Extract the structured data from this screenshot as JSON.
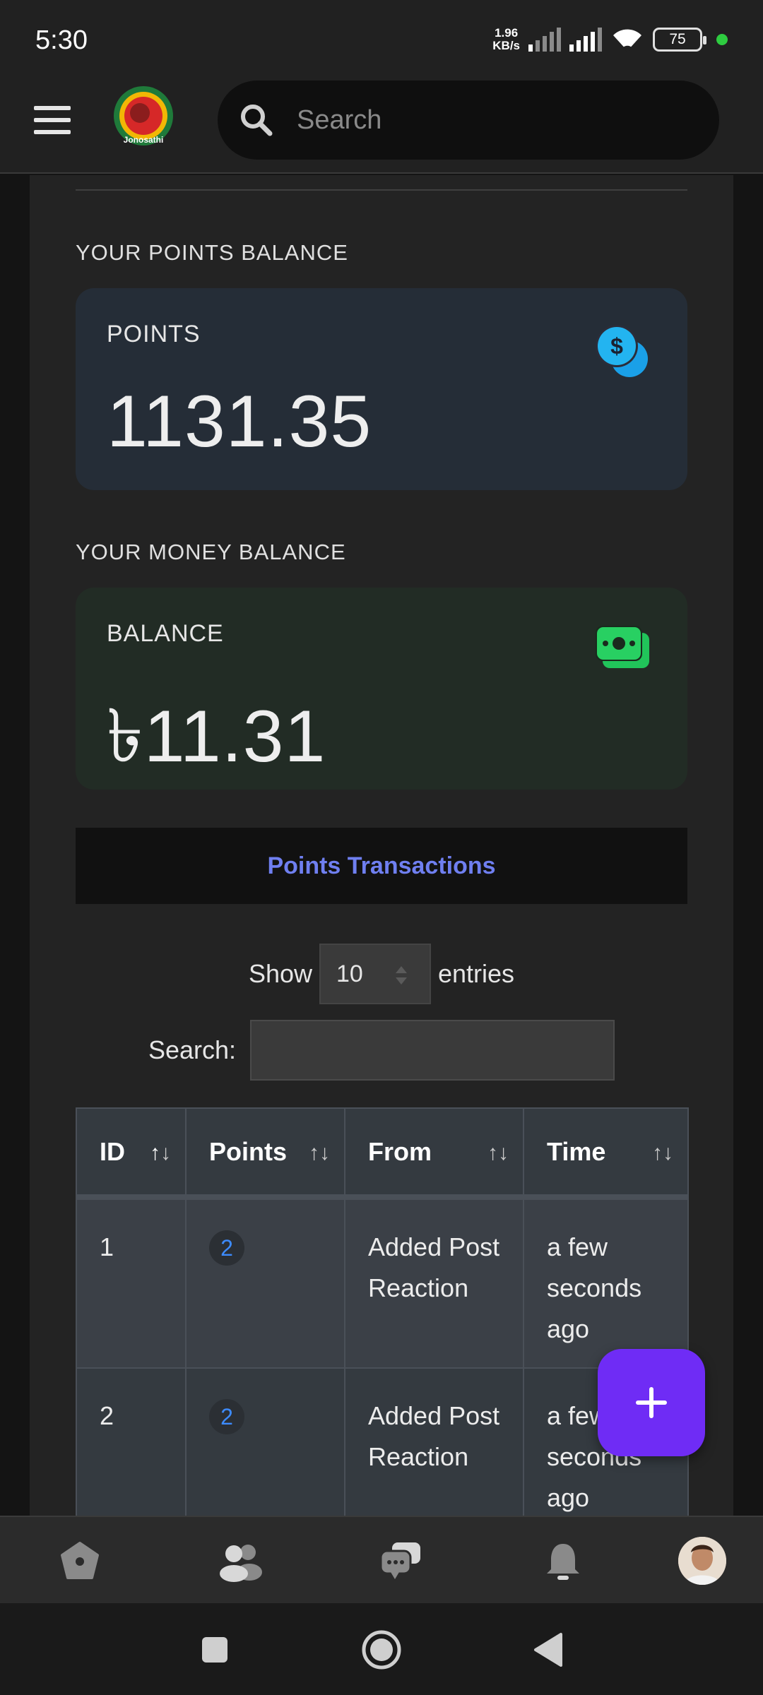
{
  "status_bar": {
    "time": "5:30",
    "net_speed_value": "1.96",
    "net_speed_unit": "KB/s",
    "battery": "75"
  },
  "header": {
    "logo_text": "Jonosathi",
    "search_placeholder": "Search"
  },
  "points_section": {
    "label": "YOUR POINTS BALANCE",
    "card_title": "POINTS",
    "value": "1131.35",
    "icon": "coin-dollar-icon"
  },
  "money_section": {
    "label": "YOUR MONEY BALANCE",
    "card_title": "BALANCE",
    "value": "৳11.31",
    "icon": "money-stack-icon"
  },
  "transactions": {
    "title": "Points Transactions",
    "show_label": "Show",
    "entries_value": "10",
    "entries_label": "entries",
    "search_label": "Search:",
    "columns": [
      "ID",
      "Points",
      "From",
      "Time"
    ],
    "sort_icon": "↑↓",
    "rows": [
      {
        "id": "1",
        "points": "2",
        "from": "Added Post Reaction",
        "time": "a few seconds ago"
      },
      {
        "id": "2",
        "points": "2",
        "from": "Added Post Reaction",
        "time": "a few seconds ago"
      }
    ]
  },
  "colors": {
    "accent": "#6f2cf5",
    "link": "#6f7ff0",
    "points_card": "#252d37",
    "money_card": "#222c25"
  },
  "bottom_nav": {
    "items": [
      "home-icon",
      "friends-icon",
      "messages-icon",
      "notifications-icon",
      "profile-avatar"
    ]
  }
}
